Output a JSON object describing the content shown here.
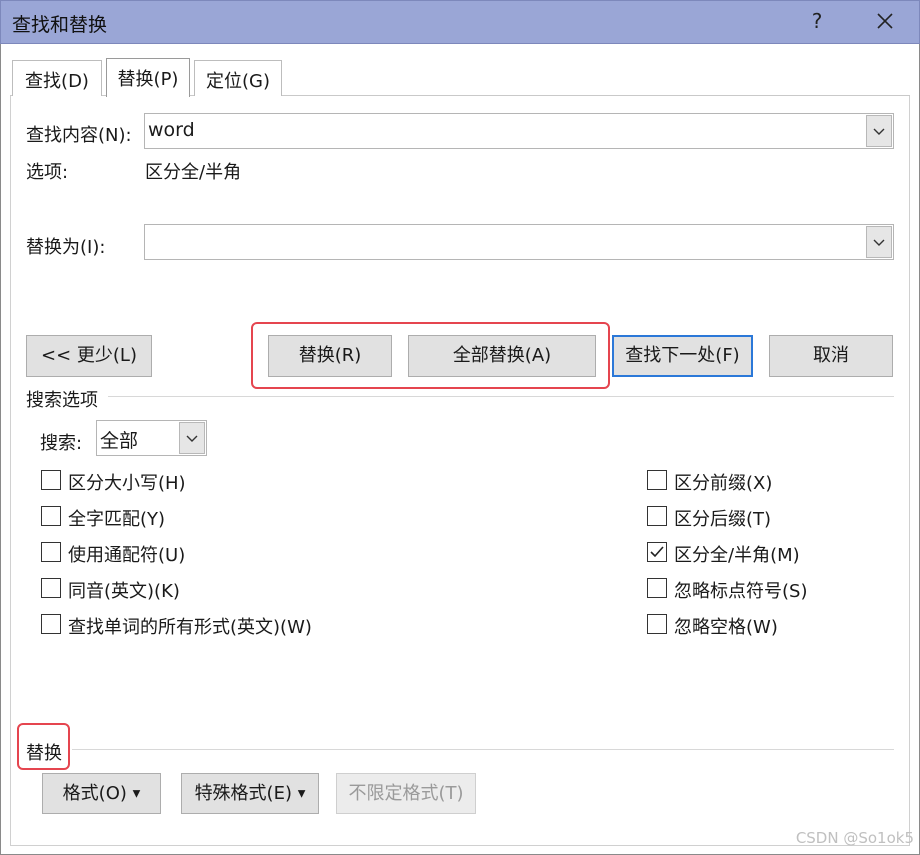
{
  "window": {
    "title": "查找和替换",
    "help": "?",
    "close": "✕"
  },
  "tabs": [
    {
      "label": "查找(D)"
    },
    {
      "label": "替换(P)"
    },
    {
      "label": "定位(G)"
    }
  ],
  "find": {
    "label": "查找内容(N):",
    "value": "word"
  },
  "options": {
    "label": "选项:",
    "value": "区分全/半角"
  },
  "replace": {
    "label": "替换为(I):",
    "value": ""
  },
  "buttons": {
    "less": "<< 更少(L)",
    "replace": "替换(R)",
    "replace_all": "全部替换(A)",
    "find_next": "查找下一处(F)",
    "cancel": "取消"
  },
  "search_options": {
    "group_title": "搜索选项",
    "search_label": "搜索:",
    "search_value": "全部",
    "left_checks": [
      {
        "label": "区分大小写(H)",
        "checked": false
      },
      {
        "label": "全字匹配(Y)",
        "checked": false
      },
      {
        "label": "使用通配符(U)",
        "checked": false
      },
      {
        "label": "同音(英文)(K)",
        "checked": false
      },
      {
        "label": "查找单词的所有形式(英文)(W)",
        "checked": false
      }
    ],
    "right_checks": [
      {
        "label": "区分前缀(X)",
        "checked": false
      },
      {
        "label": "区分后缀(T)",
        "checked": false
      },
      {
        "label": "区分全/半角(M)",
        "checked": true
      },
      {
        "label": "忽略标点符号(S)",
        "checked": false
      },
      {
        "label": "忽略空格(W)",
        "checked": false
      }
    ]
  },
  "replace_section": {
    "title": "替换",
    "format": "格式(O)",
    "special": "特殊格式(E)",
    "no_format": "不限定格式(T)"
  },
  "watermark": "CSDN @So1ok5",
  "colors": {
    "titlebar": "#9aa6d6",
    "highlight": "#e5454f",
    "focus": "#2b78d8"
  }
}
